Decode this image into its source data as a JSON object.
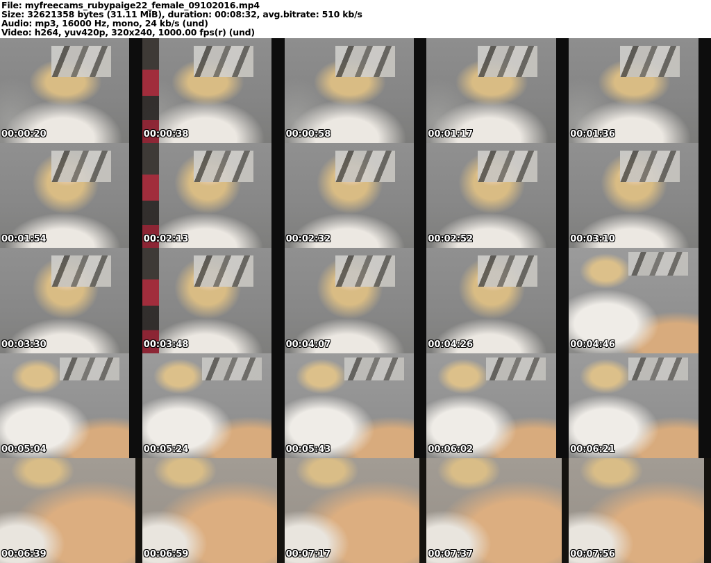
{
  "header": {
    "lines": [
      "File: myfreecams_rubypaige22_female_09102016.mp4",
      "Size: 32621358 bytes (31.11 MiB), duration: 00:08:32, avg.bitrate: 510 kb/s",
      "Audio: mp3, 16000 Hz, mono, 24 kb/s (und)",
      "Video: h264, yuv420p, 320x240, 1000.00 fps(r) (und)"
    ],
    "file_name": "myfreecams_rubypaige22_female_09102016.mp4",
    "size_bytes": "32621358",
    "size_human": "31.11 MiB",
    "duration": "00:08:32",
    "avg_bitrate": "510 kb/s",
    "audio": {
      "codec": "mp3",
      "sample_rate": "16000 Hz",
      "channels": "mono",
      "bitrate": "24 kb/s",
      "language": "und"
    },
    "video": {
      "codec": "h264",
      "pixel_format": "yuv420p",
      "resolution": "320x240",
      "framerate": "1000.00 fps(r)",
      "language": "und"
    }
  },
  "palette": {
    "page_bg": "#ffffff",
    "header_text": "#000000",
    "timestamp_text": "#ffffff",
    "timestamp_outline": "#000000",
    "wall_gray": "#8c8c8c",
    "shirt_white": "#ece8e2",
    "hair_blonde": "#d9bc84",
    "skin_tone": "#d9ab7e",
    "accent_red": "#a22838",
    "edge_bar": "#0d0d0d"
  },
  "grid": {
    "rows": 5,
    "cols": 5,
    "cells": [
      {
        "timestamp": "00:00:20"
      },
      {
        "timestamp": "00:00:38"
      },
      {
        "timestamp": "00:00:58"
      },
      {
        "timestamp": "00:01:17"
      },
      {
        "timestamp": "00:01:36"
      },
      {
        "timestamp": "00:01:54"
      },
      {
        "timestamp": "00:02:13"
      },
      {
        "timestamp": "00:02:32"
      },
      {
        "timestamp": "00:02:52"
      },
      {
        "timestamp": "00:03:10"
      },
      {
        "timestamp": "00:03:30"
      },
      {
        "timestamp": "00:03:48"
      },
      {
        "timestamp": "00:04:07"
      },
      {
        "timestamp": "00:04:26"
      },
      {
        "timestamp": "00:04:46"
      },
      {
        "timestamp": "00:05:04"
      },
      {
        "timestamp": "00:05:24"
      },
      {
        "timestamp": "00:05:43"
      },
      {
        "timestamp": "00:06:02"
      },
      {
        "timestamp": "00:06:21"
      },
      {
        "timestamp": "00:06:39"
      },
      {
        "timestamp": "00:06:59"
      },
      {
        "timestamp": "00:07:17"
      },
      {
        "timestamp": "00:07:37"
      },
      {
        "timestamp": "00:07:56"
      }
    ]
  }
}
